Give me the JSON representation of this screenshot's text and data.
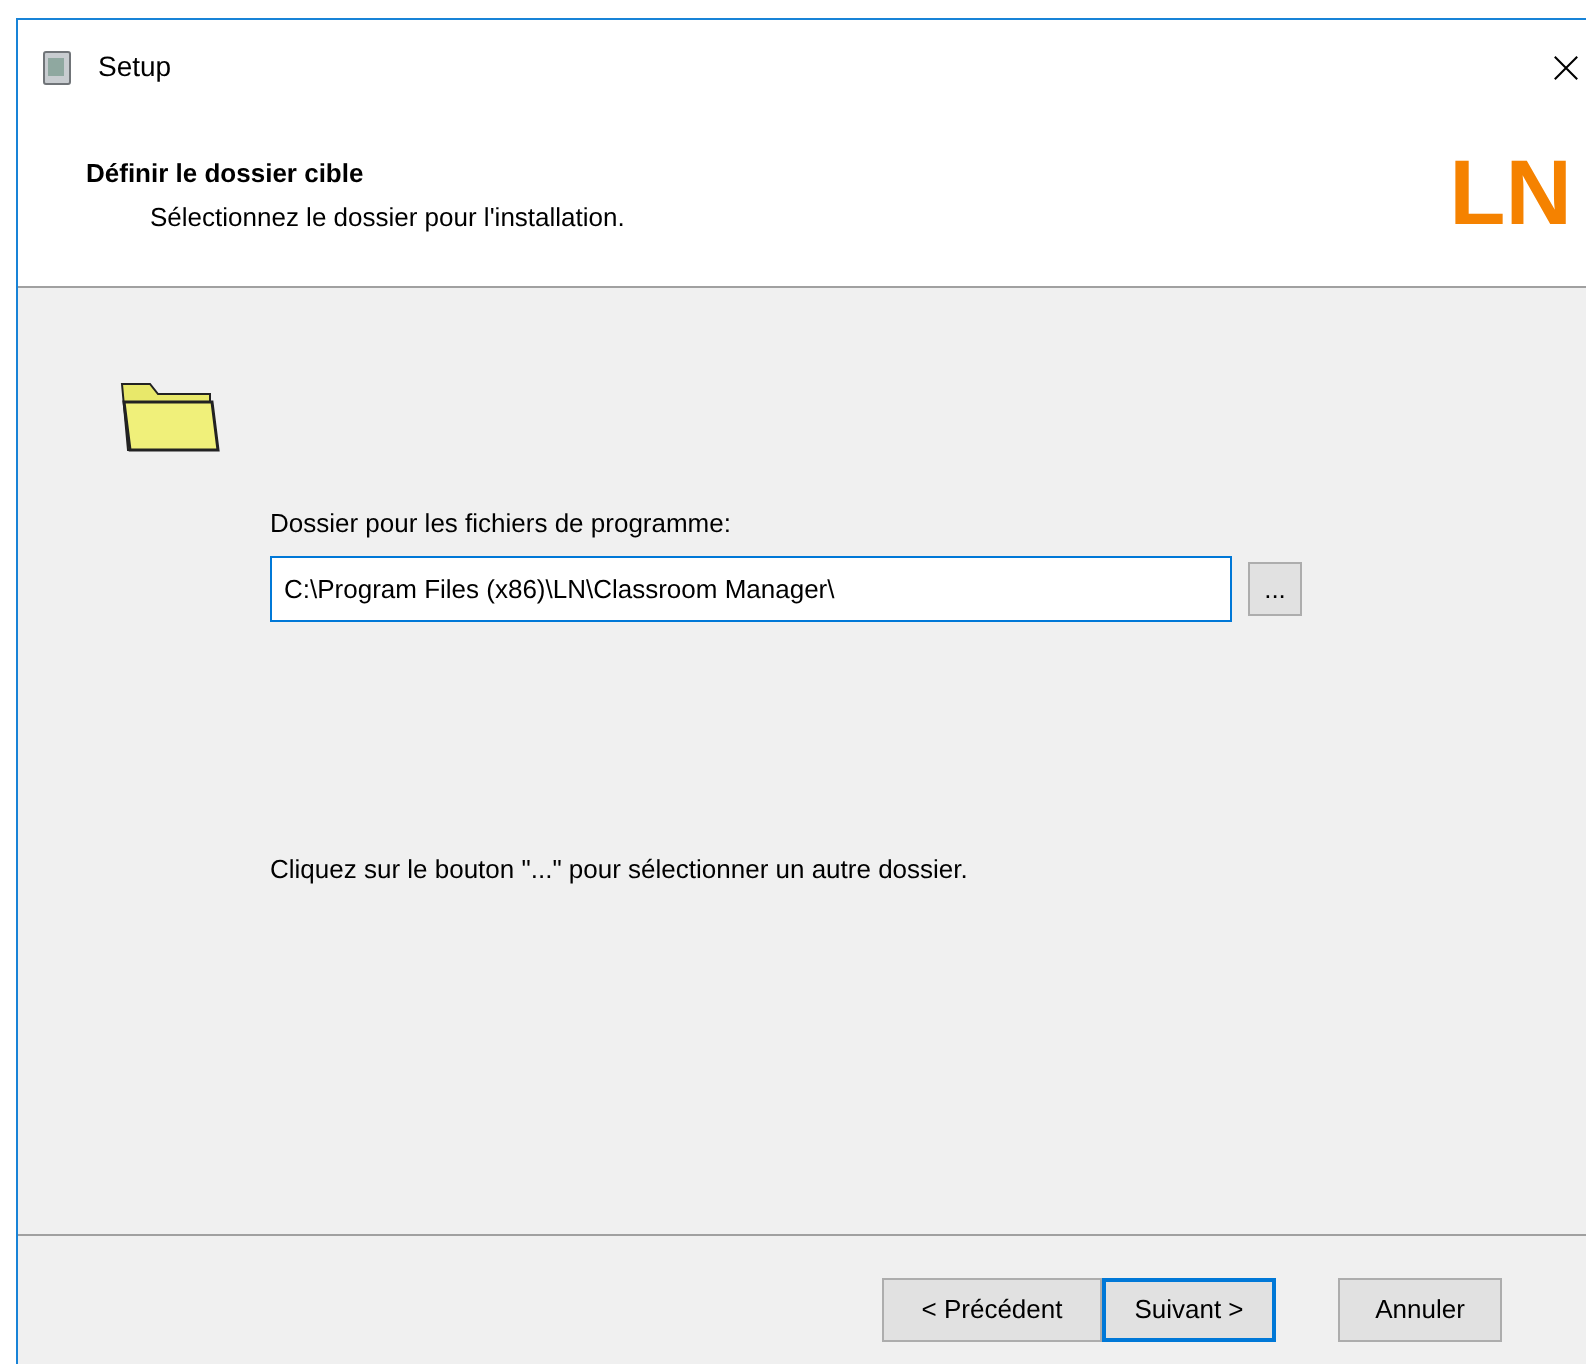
{
  "window": {
    "title": "Setup"
  },
  "header": {
    "title": "Définir le dossier cible",
    "subtitle": "Sélectionnez le dossier pour l'installation.",
    "logo": "LN"
  },
  "folder_field": {
    "label": "Dossier pour les fichiers de programme:",
    "value": "C:\\Program Files (x86)\\LN\\Classroom Manager\\",
    "browse_label": "..."
  },
  "hint": "Cliquez sur le bouton \"...\" pour sélectionner un autre dossier.",
  "buttons": [
    {
      "label": "< Précédent",
      "default": false
    },
    {
      "label": "Suivant >",
      "default": true
    },
    {
      "label": "Annuler",
      "default": false
    }
  ]
}
